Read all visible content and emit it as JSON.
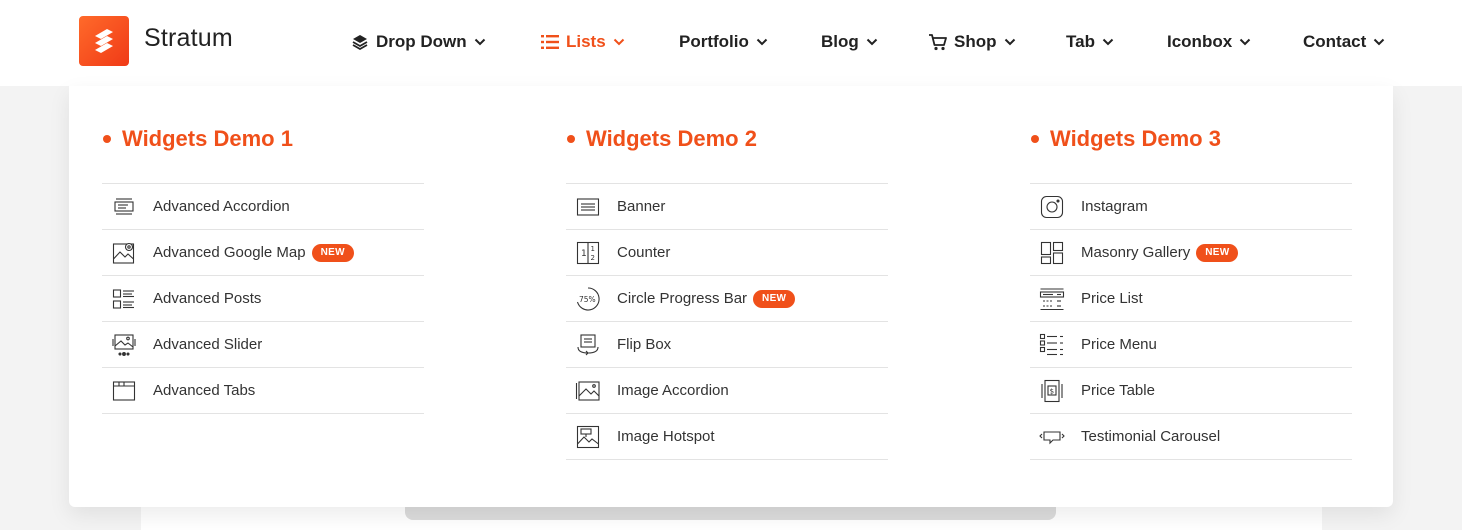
{
  "brand": {
    "name": "Stratum"
  },
  "nav": {
    "items": [
      {
        "label": "Drop Down"
      },
      {
        "label": "Lists"
      },
      {
        "label": "Portfolio"
      },
      {
        "label": "Blog"
      },
      {
        "label": "Shop"
      },
      {
        "label": "Tab"
      },
      {
        "label": "Iconbox"
      },
      {
        "label": "Contact"
      }
    ]
  },
  "menu": {
    "badge_label": "NEW",
    "columns": [
      {
        "title": "Widgets Demo 1",
        "items": [
          {
            "label": "Advanced Accordion",
            "icon": "accordion-icon"
          },
          {
            "label": "Advanced Google Map",
            "icon": "map-icon",
            "badge": true
          },
          {
            "label": "Advanced Posts",
            "icon": "posts-icon"
          },
          {
            "label": "Advanced Slider",
            "icon": "slider-icon"
          },
          {
            "label": "Advanced Tabs",
            "icon": "tabs-icon"
          }
        ]
      },
      {
        "title": "Widgets Demo 2",
        "items": [
          {
            "label": "Banner",
            "icon": "banner-icon"
          },
          {
            "label": "Counter",
            "icon": "counter-icon"
          },
          {
            "label": "Circle Progress Bar",
            "icon": "circle-progress-icon",
            "badge": true,
            "icon_text": "75%"
          },
          {
            "label": "Flip Box",
            "icon": "flip-box-icon"
          },
          {
            "label": "Image Accordion",
            "icon": "image-accordion-icon"
          },
          {
            "label": "Image Hotspot",
            "icon": "image-hotspot-icon"
          }
        ]
      },
      {
        "title": "Widgets Demo 3",
        "items": [
          {
            "label": "Instagram",
            "icon": "instagram-icon"
          },
          {
            "label": "Masonry Gallery",
            "icon": "masonry-gallery-icon",
            "badge": true
          },
          {
            "label": "Price List",
            "icon": "price-list-icon"
          },
          {
            "label": "Price Menu",
            "icon": "price-menu-icon"
          },
          {
            "label": "Price Table",
            "icon": "price-table-icon"
          },
          {
            "label": "Testimonial Carousel",
            "icon": "testimonial-carousel-icon"
          }
        ]
      }
    ]
  },
  "colors": {
    "accent": "#f0501a",
    "text": "#222222",
    "divider": "#e3e3e3"
  }
}
